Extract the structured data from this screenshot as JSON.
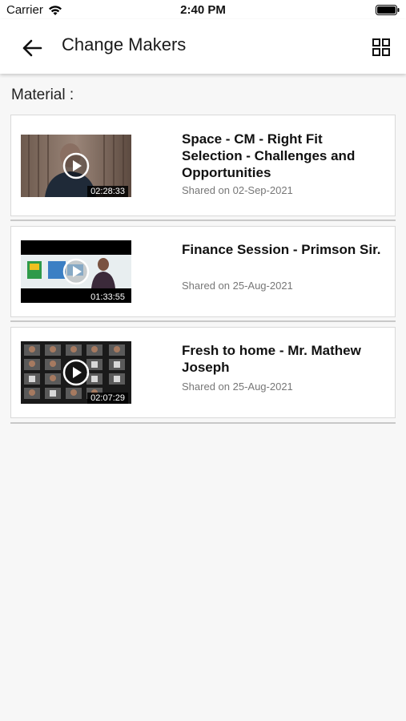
{
  "status_bar": {
    "carrier": "Carrier",
    "time": "2:40 PM",
    "wifi_icon": "wifi-icon",
    "battery_icon": "battery-icon"
  },
  "app_bar": {
    "title": "Change Makers",
    "back_icon": "arrow-left-icon",
    "grid_icon": "grid-view-icon"
  },
  "section": {
    "label": "Material :"
  },
  "materials": [
    {
      "title": "Space - CM - Right Fit Selection - Challenges and Opportunities",
      "shared": "Shared on 02-Sep-2021",
      "duration": "02:28:33"
    },
    {
      "title": "Finance Session - Primson Sir.",
      "shared": "Shared on 25-Aug-2021",
      "duration": "01:33:55"
    },
    {
      "title": "Fresh to home  - Mr. Mathew Joseph",
      "shared": "Shared on 25-Aug-2021",
      "duration": "02:07:29"
    }
  ],
  "colors": {
    "background": "#f7f7f7",
    "card": "#ffffff",
    "text_primary": "#111111",
    "text_secondary": "#777777"
  }
}
